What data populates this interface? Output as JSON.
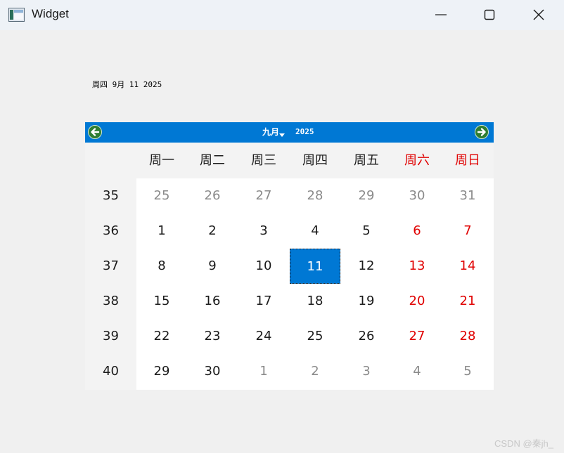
{
  "window": {
    "title": "Widget",
    "controls": [
      "minimize",
      "maximize",
      "close"
    ]
  },
  "selected_date_label": "周四 9月 11 2025",
  "calendar": {
    "nav": {
      "prev_icon": "arrow-left-icon",
      "next_icon": "arrow-right-icon",
      "month": "九月",
      "year": "2025",
      "accent": "#0078d4"
    },
    "weekdays": [
      {
        "label": "周一",
        "weekend": false
      },
      {
        "label": "周二",
        "weekend": false
      },
      {
        "label": "周三",
        "weekend": false
      },
      {
        "label": "周四",
        "weekend": false
      },
      {
        "label": "周五",
        "weekend": false
      },
      {
        "label": "周六",
        "weekend": true
      },
      {
        "label": "周日",
        "weekend": true
      }
    ],
    "weeks": [
      {
        "num": "35",
        "days": [
          {
            "d": "25",
            "other": true
          },
          {
            "d": "26",
            "other": true
          },
          {
            "d": "27",
            "other": true
          },
          {
            "d": "28",
            "other": true
          },
          {
            "d": "29",
            "other": true
          },
          {
            "d": "30",
            "other": true
          },
          {
            "d": "31",
            "other": true
          }
        ]
      },
      {
        "num": "36",
        "days": [
          {
            "d": "1"
          },
          {
            "d": "2"
          },
          {
            "d": "3"
          },
          {
            "d": "4"
          },
          {
            "d": "5"
          },
          {
            "d": "6"
          },
          {
            "d": "7"
          }
        ]
      },
      {
        "num": "37",
        "days": [
          {
            "d": "8"
          },
          {
            "d": "9"
          },
          {
            "d": "10"
          },
          {
            "d": "11",
            "selected": true
          },
          {
            "d": "12"
          },
          {
            "d": "13"
          },
          {
            "d": "14"
          }
        ]
      },
      {
        "num": "38",
        "days": [
          {
            "d": "15"
          },
          {
            "d": "16"
          },
          {
            "d": "17"
          },
          {
            "d": "18"
          },
          {
            "d": "19"
          },
          {
            "d": "20"
          },
          {
            "d": "21"
          }
        ]
      },
      {
        "num": "39",
        "days": [
          {
            "d": "22"
          },
          {
            "d": "23"
          },
          {
            "d": "24"
          },
          {
            "d": "25"
          },
          {
            "d": "26"
          },
          {
            "d": "27"
          },
          {
            "d": "28"
          }
        ]
      },
      {
        "num": "40",
        "days": [
          {
            "d": "29"
          },
          {
            "d": "30"
          },
          {
            "d": "1",
            "other": true
          },
          {
            "d": "2",
            "other": true
          },
          {
            "d": "3",
            "other": true
          },
          {
            "d": "4",
            "other": true
          },
          {
            "d": "5",
            "other": true
          }
        ]
      }
    ],
    "colors": {
      "weekend": "#e00000",
      "other_month": "#8a8a8a",
      "selected_bg": "#0078d4"
    }
  },
  "watermark": "CSDN @秦jh_"
}
